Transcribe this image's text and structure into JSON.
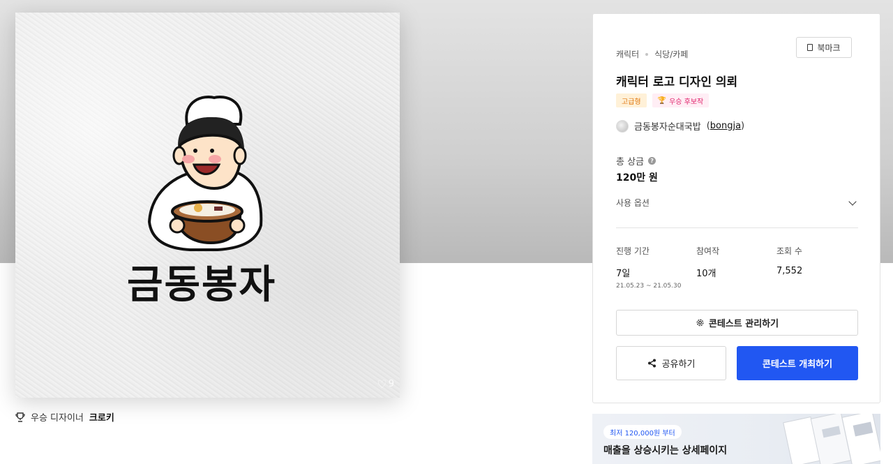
{
  "artwork": {
    "like_count": "9",
    "logo_text": "금동봉자"
  },
  "designer": {
    "prefix": "우승 디자이너",
    "name": "크로키"
  },
  "card": {
    "breadcrumb": [
      "캐릭터",
      "식당/카페"
    ],
    "bookmark_label": "북마크",
    "title": "캐릭터 로고 디자인 의뢰",
    "badges": {
      "premium": "고급형",
      "winner": "우승 후보작"
    },
    "client": {
      "name": "금동봉자순대국밥",
      "handle": "bongja"
    },
    "prize": {
      "label": "총 상금",
      "value": "120만 원"
    },
    "use_option_label": "사용 옵션",
    "stats": {
      "period_label": "진행 기간",
      "period_value": "7일",
      "period_range": "21.05.23 ~ 21.05.30",
      "entries_label": "참여작",
      "entries_value": "10개",
      "views_label": "조회 수",
      "views_value": "7,552"
    },
    "manage_button": "콘테스트 관리하기",
    "share_button": "공유하기",
    "host_button": "콘테스트 개최하기"
  },
  "promo": {
    "pill": "최저 120,000원 부터",
    "headline": "매출을 상승시키는 상세페이지"
  },
  "colors": {
    "primary": "#2157f2",
    "premium_badge": "#e0780f",
    "winner_badge": "#e0246c"
  }
}
